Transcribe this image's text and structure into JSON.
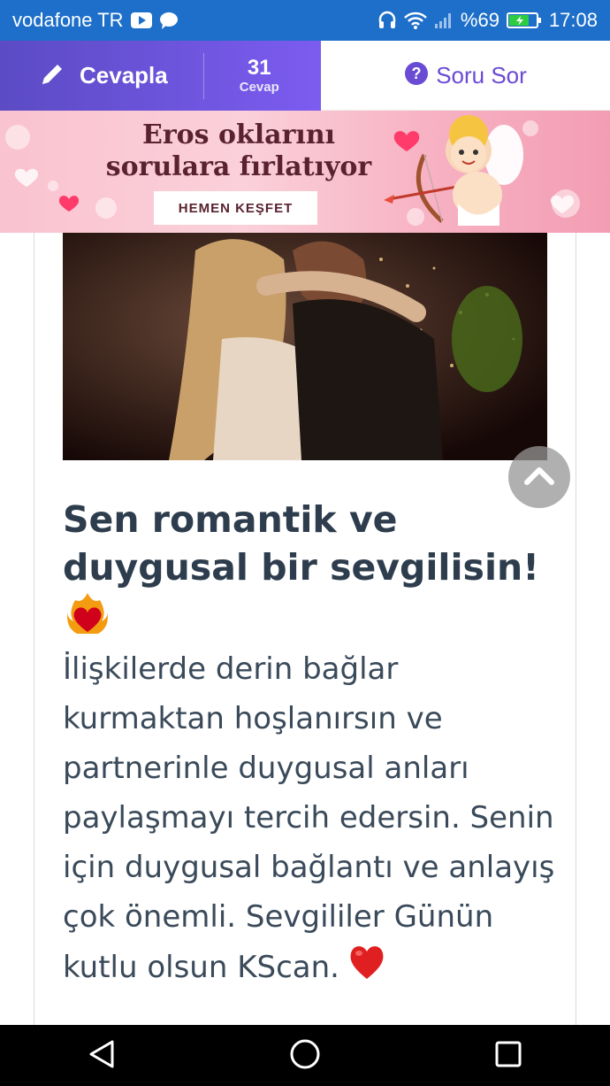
{
  "status_bar": {
    "carrier": "vodafone TR",
    "battery_percent": "%69",
    "time": "17:08",
    "icons": [
      "youtube-icon",
      "message-icon",
      "headset-icon",
      "wifi-icon",
      "signal-icon",
      "battery-icon"
    ]
  },
  "action_bar": {
    "answer_label": "Cevapla",
    "answer_count": "31",
    "answer_count_label": "Cevap",
    "ask_label": "Soru Sor",
    "accent": "#6a4bd4"
  },
  "banner": {
    "title_line1": "Eros oklarını",
    "title_line2": "sorulara fırlatıyor",
    "cta": "HEMEN KEŞFET"
  },
  "article": {
    "headline": "Sen romantik ve duygusal bir sevgilisin!",
    "headline_emoji": "heart-on-fire-icon",
    "body": "İlişkilerde derin bağlar kurmaktan hoşlanırsın ve partnerinle duygusal anları paylaşmayı tercih edersin. Senin için duygusal bağlantı ve anlayış çok önemli. Sevgililer Günün kutlu olsun KScan.",
    "body_emoji": "red-heart-icon",
    "text_color": "#2e3d4d"
  },
  "nav_bar": {
    "buttons": [
      "back-icon",
      "home-icon",
      "recents-icon"
    ]
  }
}
